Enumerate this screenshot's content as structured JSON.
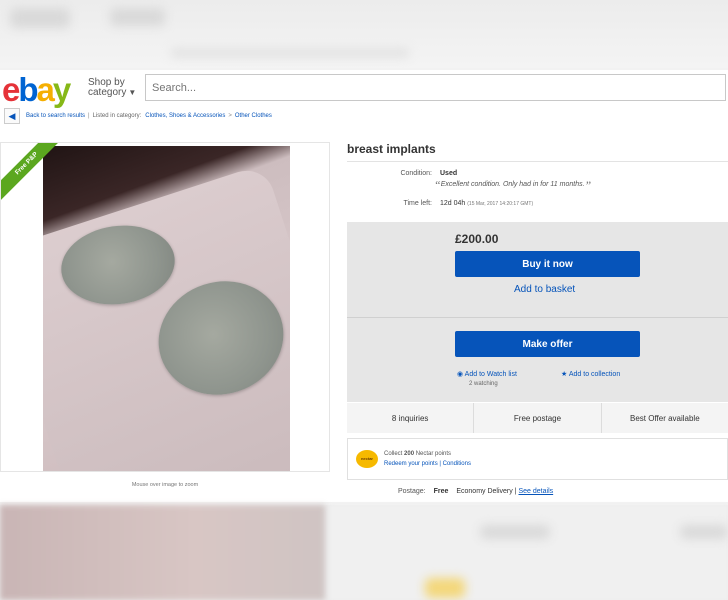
{
  "header": {
    "logo": {
      "e": "e",
      "b": "b",
      "a": "a",
      "y": "y"
    },
    "shop_by": "Shop by",
    "category": "category",
    "search_placeholder": "Search..."
  },
  "breadcrumb": {
    "back": "Back to search results",
    "listed_in": "Listed in category:",
    "cat1": "Clothes, Shoes & Accessories",
    "cat2": "Other Clothes"
  },
  "image_panel": {
    "ribbon": "Free P&P",
    "caption": "Mouse over image to zoom"
  },
  "item": {
    "title": "breast implants",
    "condition_label": "Condition:",
    "condition_value": "Used",
    "condition_note": "Excellent condition. Only had in for 11 months.",
    "time_left_label": "Time left:",
    "time_left_value": "12d 04h",
    "time_left_detail": "(15 Mar, 2017 14:20:17 GMT)",
    "price": "£200.00",
    "buy_now": "Buy it now",
    "add_to_basket": "Add to basket",
    "make_offer": "Make offer",
    "watch_list": "Add to Watch list",
    "watching": "2 watching",
    "add_collection": "Add to collection"
  },
  "info_bar": [
    "8 inquiries",
    "Free postage",
    "Best Offer available"
  ],
  "nectar": {
    "badge": "nectar",
    "collect": "Collect",
    "points": "200",
    "collect_suffix": "Nectar points",
    "redeem": "Redeem your points | Conditions"
  },
  "postage": {
    "label": "Postage:",
    "free": "Free",
    "service": "Economy Delivery",
    "sep": "|",
    "details": "See details"
  },
  "colors": {
    "brand_blue": "#0654ba",
    "ribbon_green": "#5ba71f"
  }
}
